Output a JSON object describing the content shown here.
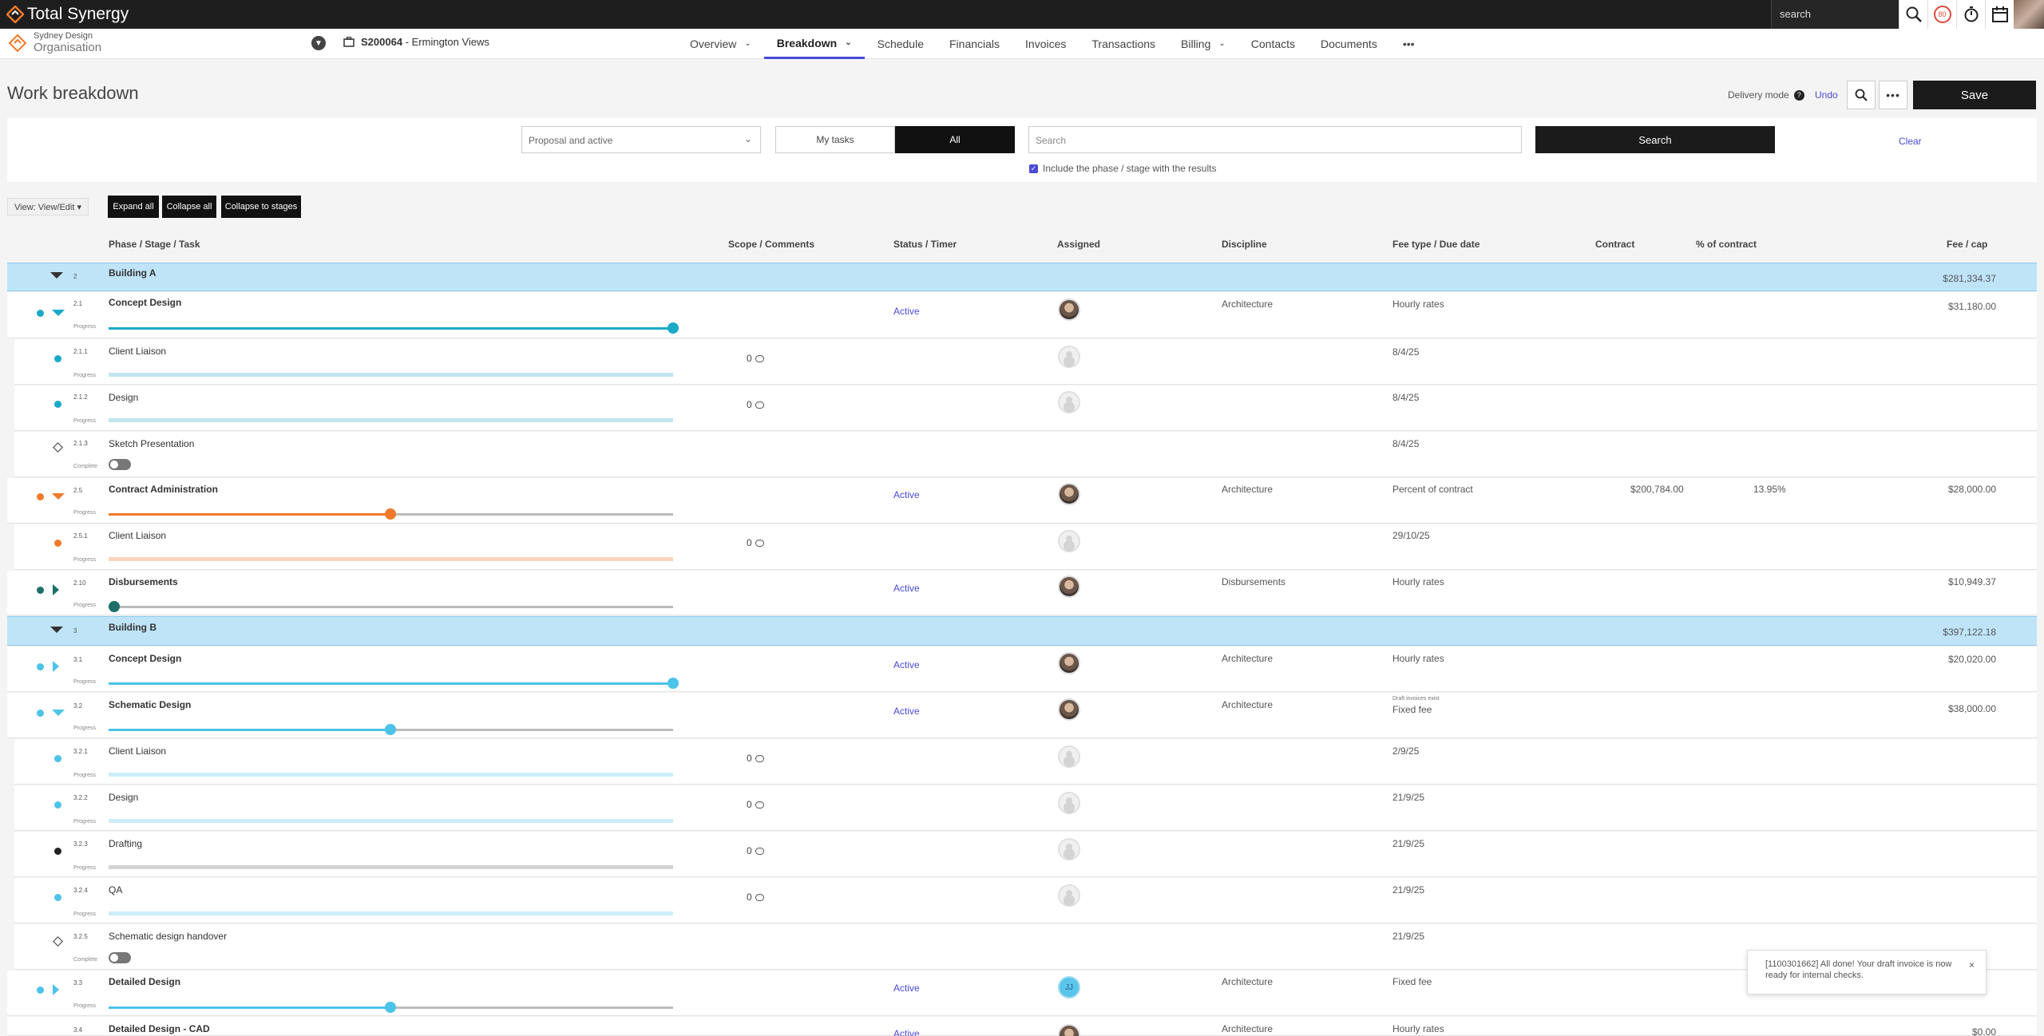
{
  "app": {
    "brand": "Total Synergy",
    "search_placeholder": "search",
    "badge_count": "80"
  },
  "org": {
    "line1": "Sydney Design",
    "line2": "Organisation"
  },
  "project": {
    "code": "S200064",
    "name": " - Ermington Views"
  },
  "nav": {
    "items": [
      {
        "label": "Overview"
      },
      {
        "label": "Breakdown"
      },
      {
        "label": "Schedule"
      },
      {
        "label": "Financials"
      },
      {
        "label": "Invoices"
      },
      {
        "label": "Transactions"
      },
      {
        "label": "Billing"
      },
      {
        "label": "Contacts"
      },
      {
        "label": "Documents"
      }
    ],
    "more": "•••"
  },
  "page": {
    "title": "Work breakdown",
    "delivery_mode": "Delivery mode",
    "undo": "Undo",
    "save": "Save"
  },
  "filters": {
    "status_value": "Proposal and active",
    "my_tasks": "My tasks",
    "all": "All",
    "search_placeholder": "Search",
    "search_button": "Search",
    "clear": "Clear",
    "include_label": "Include the phase / stage with the results"
  },
  "view": {
    "view_label": "View: View/Edit ▾",
    "expand_all": "Expand all",
    "collapse_all": "Collapse all",
    "collapse_to_stages": "Collapse to stages"
  },
  "columns": {
    "phase": "Phase / Stage / Task",
    "scope": "Scope / Comments",
    "status": "Status / Timer",
    "assigned": "Assigned",
    "discipline": "Discipline",
    "fee_type": "Fee type / Due date",
    "contract": "Contract",
    "pct": "% of contract",
    "fee": "Fee / cap"
  },
  "labels": {
    "progress": "Progress",
    "complete": "Complete",
    "comments_zero": "0",
    "draft_invoices": "Draft invoices exist"
  },
  "rows": [
    {
      "num": "2",
      "name": "Building A",
      "fee": "$281,334.37"
    },
    {
      "num": "2.1",
      "name": "Concept Design",
      "status": "Active",
      "discipline": "Architecture",
      "fee_type": "Hourly rates",
      "fee": "$31,180.00"
    },
    {
      "num": "2.1.1",
      "name": "Client Liaison",
      "due": "8/4/25"
    },
    {
      "num": "2.1.2",
      "name": "Design",
      "due": "8/4/25"
    },
    {
      "num": "2.1.3",
      "name": "Sketch Presentation",
      "due": "8/4/25"
    },
    {
      "num": "2.5",
      "name": "Contract Administration",
      "status": "Active",
      "discipline": "Architecture",
      "fee_type": "Percent of contract",
      "contract": "$200,784.00",
      "pct": "13.95%",
      "fee": "$28,000.00"
    },
    {
      "num": "2.5.1",
      "name": "Client Liaison",
      "due": "29/10/25"
    },
    {
      "num": "2.10",
      "name": "Disbursements",
      "status": "Active",
      "discipline": "Disbursements",
      "fee_type": "Hourly rates",
      "fee": "$10,949.37"
    },
    {
      "num": "3",
      "name": "Building B",
      "fee": "$397,122.18"
    },
    {
      "num": "3.1",
      "name": "Concept Design",
      "status": "Active",
      "discipline": "Architecture",
      "fee_type": "Hourly rates",
      "fee": "$20,020.00"
    },
    {
      "num": "3.2",
      "name": "Schematic Design",
      "status": "Active",
      "discipline": "Architecture",
      "fee_type": "Fixed fee",
      "fee": "$38,000.00"
    },
    {
      "num": "3.2.1",
      "name": "Client Liaison",
      "due": "2/9/25"
    },
    {
      "num": "3.2.2",
      "name": "Design",
      "due": "21/9/25"
    },
    {
      "num": "3.2.3",
      "name": "Drafting",
      "due": "21/9/25"
    },
    {
      "num": "3.2.4",
      "name": "QA",
      "due": "21/9/25"
    },
    {
      "num": "3.2.5",
      "name": "Schematic design handover",
      "due": "21/9/25"
    },
    {
      "num": "3.3",
      "name": "Detailed Design",
      "status": "Active",
      "discipline": "Architecture",
      "fee_type": "Fixed fee",
      "initials": "JJ"
    },
    {
      "num": "3.4",
      "name": "Detailed Design - CAD",
      "status": "Active",
      "discipline": "Architecture",
      "fee_type": "Hourly rates",
      "fee": "$0.00"
    }
  ],
  "progress": {
    "concept_a": 1.0,
    "contract_admin": 0.5,
    "disbursements": 0.0,
    "concept_b": 1.0,
    "schematic": 0.5,
    "detailed": 0.5
  },
  "colors": {
    "accent": "#4a4ad6",
    "building_row": "#bfe4f8",
    "teal": "#1aa9c9",
    "orange": "#f07a2a",
    "dark_teal": "#1e6f6a",
    "light_blue": "#4cc3e8"
  },
  "toast": {
    "message": "[1100301662] All done! Your draft invoice is now ready for internal checks.",
    "close": "×"
  }
}
